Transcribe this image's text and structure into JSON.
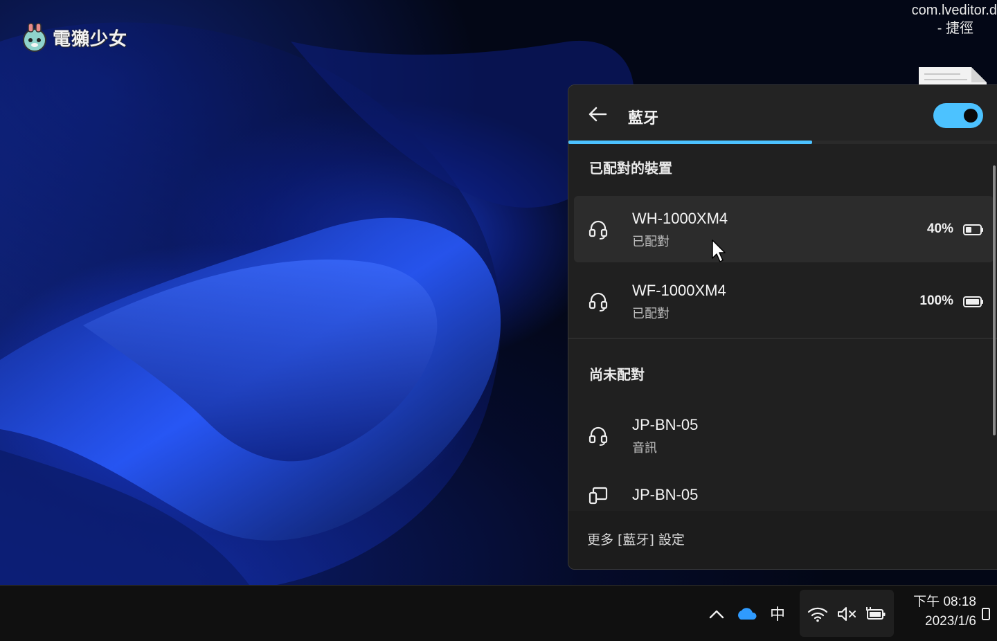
{
  "desktop": {
    "logo_text": "電獺少女",
    "shortcut_label_line1": "com.lveditor.d",
    "shortcut_label_line2": "- 捷徑"
  },
  "bluetooth_flyout": {
    "title": "藍牙",
    "toggle_on": true,
    "loading_progress_fraction": 0.56,
    "paired_section_title": "已配對的裝置",
    "paired_devices": [
      {
        "name": "WH-1000XM4",
        "status": "已配對",
        "battery": "40%",
        "icon": "headset-icon"
      },
      {
        "name": "WF-1000XM4",
        "status": "已配對",
        "battery": "100%",
        "icon": "headset-icon"
      }
    ],
    "unpaired_section_title": "尚未配對",
    "unpaired_devices": [
      {
        "name": "JP-BN-05",
        "status": "音訊",
        "icon": "headset-icon"
      },
      {
        "name": "JP-BN-05",
        "status": "",
        "icon": "phone-device-icon"
      }
    ],
    "more_settings_link": "更多 [藍牙] 設定",
    "accent_color": "#4cc2ff"
  },
  "taskbar": {
    "ime_indicator": "中",
    "time": "下午 08:18",
    "date": "2023/1/6",
    "tray_icons": [
      "chevron-up-icon",
      "onedrive-cloud-icon",
      "wifi-icon",
      "volume-muted-icon",
      "battery-charging-icon",
      "notification-icon"
    ]
  }
}
